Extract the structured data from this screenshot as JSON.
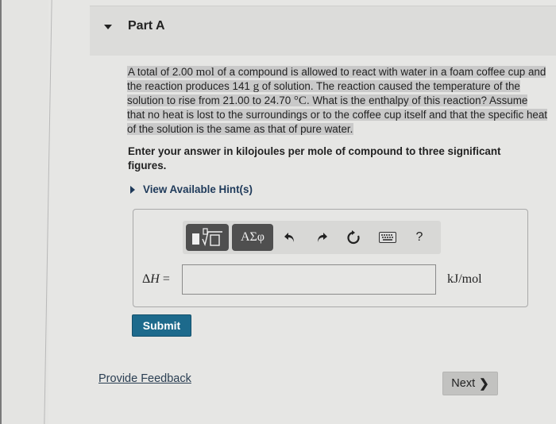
{
  "part": {
    "title": "Part A",
    "expanded": true
  },
  "question": {
    "segments": [
      {
        "text": "A total of 2.00 ",
        "style": "normal"
      },
      {
        "text": "mol",
        "style": "serif"
      },
      {
        "text": " of a compound is allowed to react with water in a foam coffee cup and the reaction produces 141 ",
        "style": "normal"
      },
      {
        "text": "g",
        "style": "serif"
      },
      {
        "text": " of solution. The reaction caused the temperature of the solution to rise from 21.00  to 24.70 ",
        "style": "normal"
      },
      {
        "text": "°C",
        "style": "serif"
      },
      {
        "text": ". What is the enthalpy of this reaction? Assume that no heat is lost to the surroundings or to the coffee cup itself and that the specific heat of the solution is the same as that of pure water.",
        "style": "normal"
      }
    ],
    "instruction": "Enter your answer in kilojoules per mole of compound to three significant figures."
  },
  "hint": {
    "label": "View Available Hint(s)"
  },
  "toolbar": {
    "templates_label": "templates",
    "greek_label": "ΑΣφ",
    "undo": "undo-icon",
    "redo": "redo-icon",
    "reset": "reset-icon",
    "keyboard": "keyboard-icon",
    "help_label": "?"
  },
  "answer": {
    "label_delta": "Δ",
    "label_var": "H",
    "label_eq": " =",
    "value": "",
    "unit": "kJ/mol"
  },
  "actions": {
    "submit_label": "Submit",
    "feedback_label": "Provide Feedback",
    "next_label": "Next",
    "next_glyph": "❯"
  },
  "colors": {
    "submit_bg": "#1d6a8c",
    "toolbar_dark": "#4f4f4f",
    "highlight": "#c9c9c9"
  }
}
